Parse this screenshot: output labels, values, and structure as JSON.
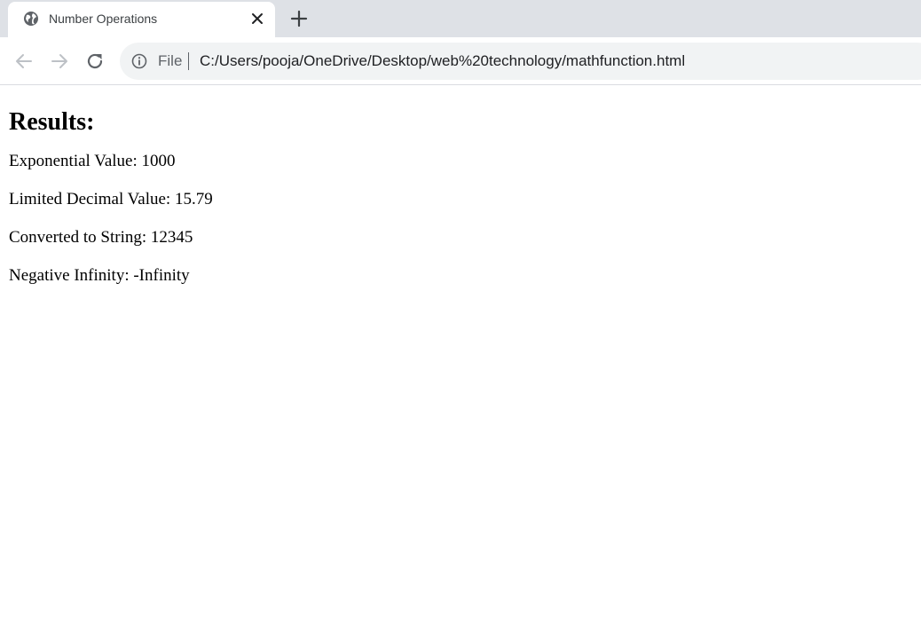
{
  "browser": {
    "tab": {
      "title": "Number Operations",
      "favicon": "globe-icon"
    },
    "new_tab_icon": "plus-icon",
    "nav": {
      "back_icon": "back-arrow-icon",
      "forward_icon": "forward-arrow-icon",
      "reload_icon": "reload-icon"
    },
    "omnibox": {
      "info_icon": "info-icon",
      "scheme": "File",
      "url": "C:/Users/pooja/OneDrive/Desktop/web%20technology/mathfunction.html"
    }
  },
  "page": {
    "heading": "Results:",
    "results": [
      "Exponential Value: 1000",
      "Limited Decimal Value: 15.79",
      "Converted to String: 12345",
      "Negative Infinity: -Infinity"
    ]
  },
  "colors": {
    "tabstrip": "#dee1e6",
    "omnibox": "#f1f3f4",
    "icon": "#5f6368",
    "text": "#000000"
  }
}
